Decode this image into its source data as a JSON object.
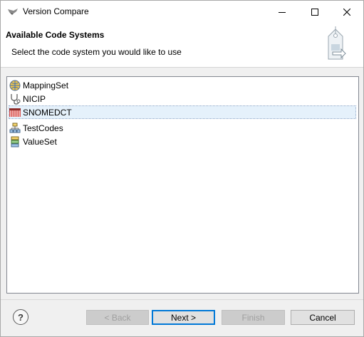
{
  "window": {
    "title": "Version Compare"
  },
  "banner": {
    "title": "Available Code Systems",
    "description": "Select the code system you would like to use"
  },
  "code_systems": [
    {
      "label": "MappingSet",
      "icon": "globe-icon"
    },
    {
      "label": "NICIP",
      "icon": "stethoscope-icon"
    },
    {
      "label": "SNOMEDCT",
      "icon": "snomed-icon",
      "selected": true
    },
    {
      "label": "TestCodes",
      "icon": "hierarchy-icon"
    },
    {
      "label": "ValueSet",
      "icon": "stack-icon"
    }
  ],
  "buttons": {
    "help": "?",
    "back": "< Back",
    "next": "Next >",
    "finish": "Finish",
    "cancel": "Cancel"
  },
  "colors": {
    "selection": "#e5f1fb",
    "default_button_border": "#0078d7"
  }
}
